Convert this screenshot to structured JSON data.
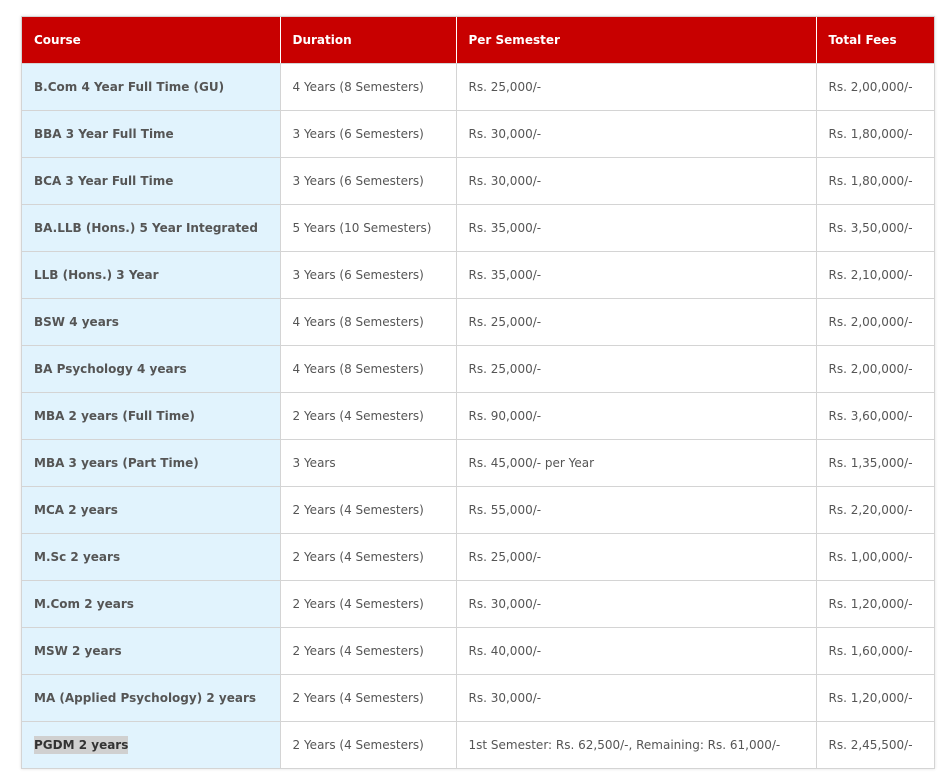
{
  "table": {
    "headers": [
      "Course",
      "Duration",
      "Per Semester",
      "Total Fees"
    ],
    "rows": [
      {
        "course": "B.Com 4 Year Full Time (GU)",
        "duration": "4 Years (8 Semesters)",
        "per_semester": "Rs. 25,000/-",
        "total": "Rs. 2,00,000/-"
      },
      {
        "course": "BBA 3 Year Full Time",
        "duration": "3 Years (6 Semesters)",
        "per_semester": "Rs. 30,000/-",
        "total": "Rs. 1,80,000/-"
      },
      {
        "course": "BCA 3 Year Full Time",
        "duration": "3 Years (6 Semesters)",
        "per_semester": "Rs. 30,000/-",
        "total": "Rs. 1,80,000/-"
      },
      {
        "course": "BA.LLB (Hons.) 5 Year Integrated",
        "duration": "5 Years (10 Semesters)",
        "per_semester": "Rs. 35,000/-",
        "total": "Rs. 3,50,000/-"
      },
      {
        "course": "LLB (Hons.) 3 Year",
        "duration": "3 Years (6 Semesters)",
        "per_semester": "Rs. 35,000/-",
        "total": "Rs. 2,10,000/-"
      },
      {
        "course": "BSW 4 years",
        "duration": "4 Years (8 Semesters)",
        "per_semester": "Rs. 25,000/-",
        "total": "Rs. 2,00,000/-"
      },
      {
        "course": "BA Psychology 4 years",
        "duration": "4 Years (8 Semesters)",
        "per_semester": "Rs. 25,000/-",
        "total": "Rs. 2,00,000/-"
      },
      {
        "course": "MBA 2 years (Full Time)",
        "duration": "2 Years (4 Semesters)",
        "per_semester": "Rs. 90,000/-",
        "total": "Rs. 3,60,000/-"
      },
      {
        "course": "MBA 3 years (Part Time)",
        "duration": "3 Years",
        "per_semester": "Rs. 45,000/- per Year",
        "total": "Rs. 1,35,000/-"
      },
      {
        "course": "MCA 2 years",
        "duration": "2 Years (4 Semesters)",
        "per_semester": "Rs. 55,000/-",
        "total": "Rs. 2,20,000/-"
      },
      {
        "course": "M.Sc 2 years",
        "duration": "2 Years (4 Semesters)",
        "per_semester": "Rs. 25,000/-",
        "total": "Rs. 1,00,000/-"
      },
      {
        "course": "M.Com 2 years",
        "duration": "2 Years (4 Semesters)",
        "per_semester": "Rs. 30,000/-",
        "total": "Rs. 1,20,000/-"
      },
      {
        "course": "MSW 2 years",
        "duration": "2 Years (4 Semesters)",
        "per_semester": "Rs. 40,000/-",
        "total": "Rs. 1,60,000/-"
      },
      {
        "course": "MA (Applied Psychology) 2 years",
        "duration": "2 Years (4 Semesters)",
        "per_semester": "Rs. 30,000/-",
        "total": "Rs. 1,20,000/-"
      },
      {
        "course": "PGDM 2 years",
        "duration": "2 Years (4 Semesters)",
        "per_semester": "1st Semester: Rs. 62,500/-, Remaining: Rs. 61,000/-",
        "total": "Rs. 2,45,500/-"
      }
    ]
  },
  "colors": {
    "header_bg": "#c80000",
    "course_col_bg": "#e1f3fd",
    "text": "#555555",
    "selection_highlight": "#d0d0d0"
  }
}
